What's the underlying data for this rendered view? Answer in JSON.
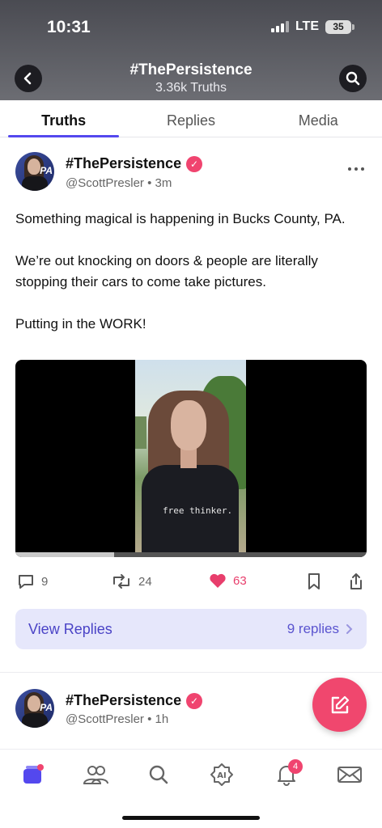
{
  "status_bar": {
    "time": "10:31",
    "network": "LTE",
    "battery": "35"
  },
  "header": {
    "title": "#ThePersistence",
    "subtitle": "3.36k Truths",
    "back_icon": "chevron-left-icon",
    "search_icon": "search-icon"
  },
  "tabs": [
    {
      "label": "Truths",
      "active": true
    },
    {
      "label": "Replies",
      "active": false
    },
    {
      "label": "Media",
      "active": false
    }
  ],
  "post": {
    "author": "#ThePersistence",
    "handle": "@ScottPresler",
    "separator": "•",
    "time": "3m",
    "paragraphs": [
      "Something magical is happening in Bucks County, PA.",
      "We’re out knocking on doors & people are literally stopping their cars to come take pictures.",
      "Putting in the WORK!"
    ],
    "video": {
      "shirt_text": "free thinker.",
      "progress": 0.28
    },
    "actions": {
      "replies": "9",
      "retruths": "24",
      "likes": "63"
    },
    "view_replies": {
      "label": "View Replies",
      "count": "9 replies"
    }
  },
  "next_post": {
    "author": "#ThePersistence",
    "handle": "@ScottPresler",
    "separator": "•",
    "time": "1h"
  },
  "avatar_badge": "PA",
  "bottom_nav": {
    "notifications_badge": "4",
    "ai_label": "AI"
  },
  "colors": {
    "accent": "#5448ee",
    "like": "#e83e6c",
    "verified": "#f0446f",
    "fab": "#f0476e",
    "replies_bg": "#e6e7fb"
  }
}
